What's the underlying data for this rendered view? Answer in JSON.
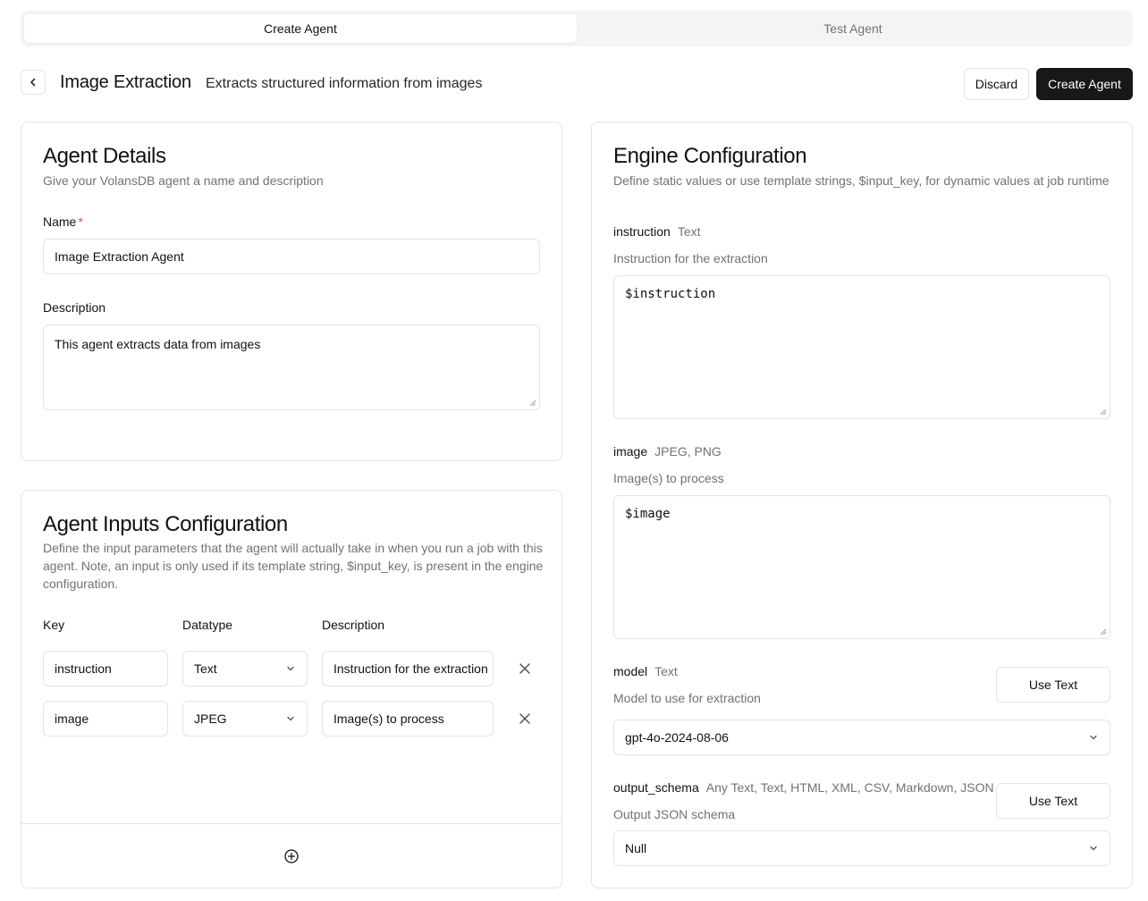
{
  "tabs": [
    {
      "label": "Create Agent",
      "active": true
    },
    {
      "label": "Test Agent",
      "active": false
    }
  ],
  "header": {
    "title": "Image Extraction",
    "subtitle": "Extracts structured information from images",
    "discard_label": "Discard",
    "create_label": "Create Agent"
  },
  "agent_details": {
    "title": "Agent Details",
    "description": "Give your VolansDB agent a name and description",
    "name_label": "Name",
    "required_mark": "*",
    "name_value": "Image Extraction Agent",
    "description_label": "Description",
    "description_value": "This agent extracts data from images"
  },
  "inputs_config": {
    "title": "Agent Inputs Configuration",
    "description": "Define the input parameters that the agent will actually take in when you run a job with this agent. Note, an input is only used if its template string, $input_key, is present in the engine configuration.",
    "columns": [
      "Key",
      "Datatype",
      "Description"
    ],
    "rows": [
      {
        "key": "instruction",
        "datatype": "Text",
        "description": "Instruction for the extraction"
      },
      {
        "key": "image",
        "datatype": "JPEG",
        "description": "Image(s) to process"
      }
    ]
  },
  "engine_config": {
    "title": "Engine Configuration",
    "description": "Define static values or use template strings, $input_key, for dynamic values at job runtime",
    "fields": {
      "instruction": {
        "name": "instruction",
        "type": "Text",
        "help": "Instruction for the extraction",
        "value": "$instruction"
      },
      "image": {
        "name": "image",
        "type": "JPEG, PNG",
        "help": "Image(s) to process",
        "value": "$image"
      },
      "model": {
        "name": "model",
        "type": "Text",
        "help": "Model to use for extraction",
        "value": "gpt-4o-2024-08-06",
        "button": "Use Text"
      },
      "output_schema": {
        "name": "output_schema",
        "type": "Any Text, Text, HTML, XML, CSV, Markdown, JSON",
        "help": "Output JSON schema",
        "value": "Null",
        "button": "Use Text"
      }
    }
  },
  "colors": {
    "primary": "#18181b",
    "border": "#e4e4e7",
    "muted_text": "#71717a",
    "required": "#ef4444",
    "tab_bg": "#f4f4f5"
  }
}
